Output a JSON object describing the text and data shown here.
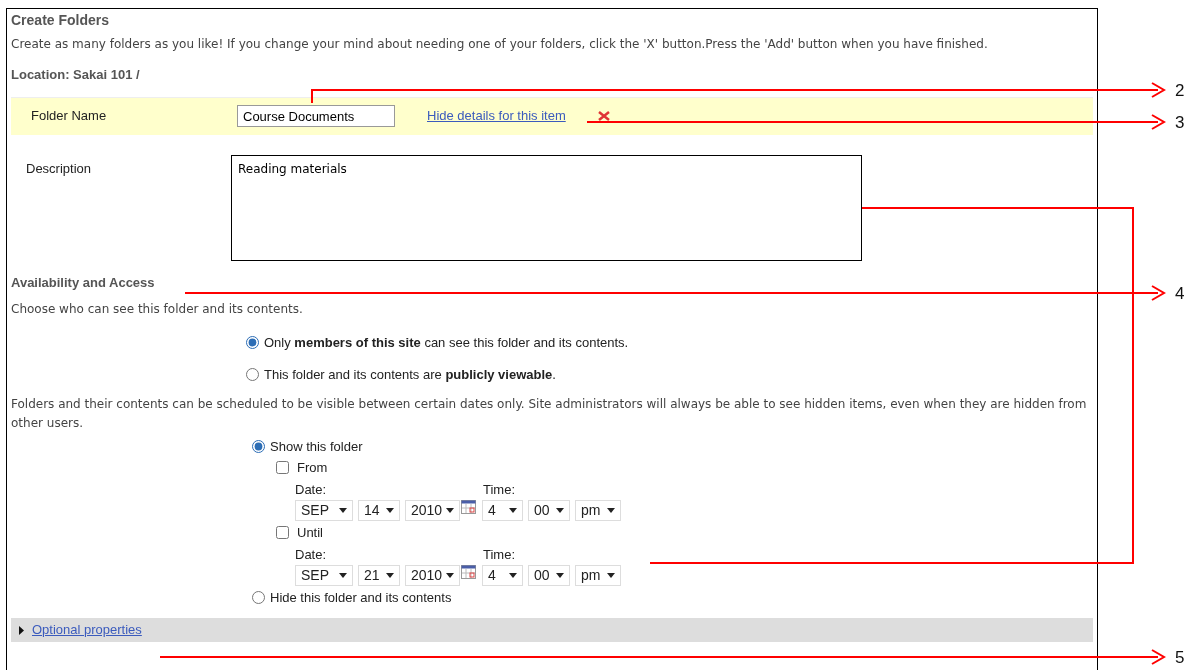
{
  "title": "Create Folders",
  "instructions": "Create as many folders as you like! If you change your mind about needing one of your folders, click the 'X' button.Press the 'Add' button when you have finished.",
  "location": "Location: Sakai 101 /",
  "folder": {
    "label": "Folder Name",
    "value": "Course Documents",
    "details_link": "Hide details for this item"
  },
  "description": {
    "label": "Description",
    "value": "Reading materials"
  },
  "access": {
    "heading": "Availability and Access",
    "intro": "Choose who can see this folder and its contents.",
    "options": [
      {
        "text": "Only **members of this site** can see this folder and its contents.",
        "selected": true
      },
      {
        "text": "This folder and its contents are **publicly viewable**.",
        "selected": false
      }
    ]
  },
  "schedule": {
    "intro": "Folders and their contents can be scheduled to be visible between certain dates only. Site administrators will always be able to see hidden items, even when they are hidden from other users.",
    "show": {
      "label": "Show this folder",
      "selected": true
    },
    "ranges": [
      {
        "label": "From",
        "checked": false,
        "date_label": "Date:",
        "time_label": "Time:",
        "month": "SEP",
        "day": "14",
        "year": "2010",
        "hour": "4",
        "minute": "00",
        "ampm": "pm"
      },
      {
        "label": "Until",
        "checked": false,
        "date_label": "Date:",
        "time_label": "Time:",
        "month": "SEP",
        "day": "21",
        "year": "2010",
        "hour": "4",
        "minute": "00",
        "ampm": "pm"
      }
    ],
    "hide": {
      "label": "Hide this folder and its contents",
      "selected": false
    }
  },
  "optional": {
    "label": "Optional properties",
    "expanded": false
  },
  "callouts": [
    {
      "number": "2"
    },
    {
      "number": "3"
    },
    {
      "number": "4"
    },
    {
      "number": "5"
    }
  ]
}
